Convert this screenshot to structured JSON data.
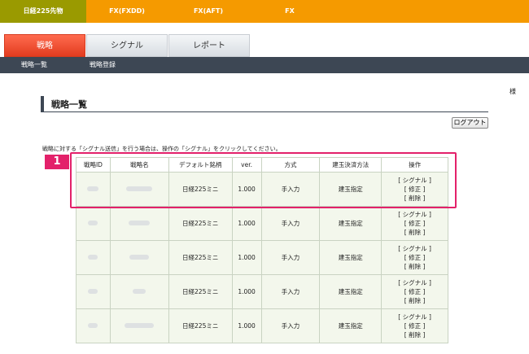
{
  "top_nav": {
    "tabs": [
      {
        "label": "日経225先物",
        "active": true
      },
      {
        "label": "FX(FXDD)",
        "active": false
      },
      {
        "label": "FX(AFT)",
        "active": false
      },
      {
        "label": "FX",
        "active": false
      }
    ]
  },
  "main_tabs": [
    {
      "label": "戦略",
      "active": true
    },
    {
      "label": "シグナル",
      "active": false
    },
    {
      "label": "レポート",
      "active": false
    }
  ],
  "sub_nav": [
    "戦略一覧",
    "戦略登録"
  ],
  "user_suffix": "様",
  "page_title": "戦略一覧",
  "logout_label": "ログアウト",
  "instruction": "戦略に対する「シグナル送信」を行う場合は、操作の「シグナル」をクリックしてください。",
  "highlight_badge": "1",
  "table": {
    "headers": [
      "戦略ID",
      "戦略名",
      "デフォルト銘柄",
      "ver.",
      "方式",
      "建玉決済方法",
      "操作"
    ],
    "rows": [
      {
        "symbol": "日経225ミニ",
        "version": "1.000",
        "method": "手入力",
        "settlement": "建玉指定"
      },
      {
        "symbol": "日経225ミニ",
        "version": "1.000",
        "method": "手入力",
        "settlement": "建玉指定"
      },
      {
        "symbol": "日経225ミニ",
        "version": "1.000",
        "method": "手入力",
        "settlement": "建玉指定"
      },
      {
        "symbol": "日経225ミニ",
        "version": "1.000",
        "method": "手入力",
        "settlement": "建玉指定"
      },
      {
        "symbol": "日経225ミニ",
        "version": "1.000",
        "method": "手入力",
        "settlement": "建玉指定"
      }
    ],
    "ops": [
      "[ シグナル ]",
      "[ 修正 ]",
      "[ 削除 ]"
    ]
  },
  "colors": {
    "top_bar": "#f59a00",
    "top_active": "#9a9a00",
    "tab_active": "#e23c1f",
    "sub_nav": "#3d4754",
    "highlight": "#e3216a",
    "row_bg": "#f3f7ec"
  }
}
